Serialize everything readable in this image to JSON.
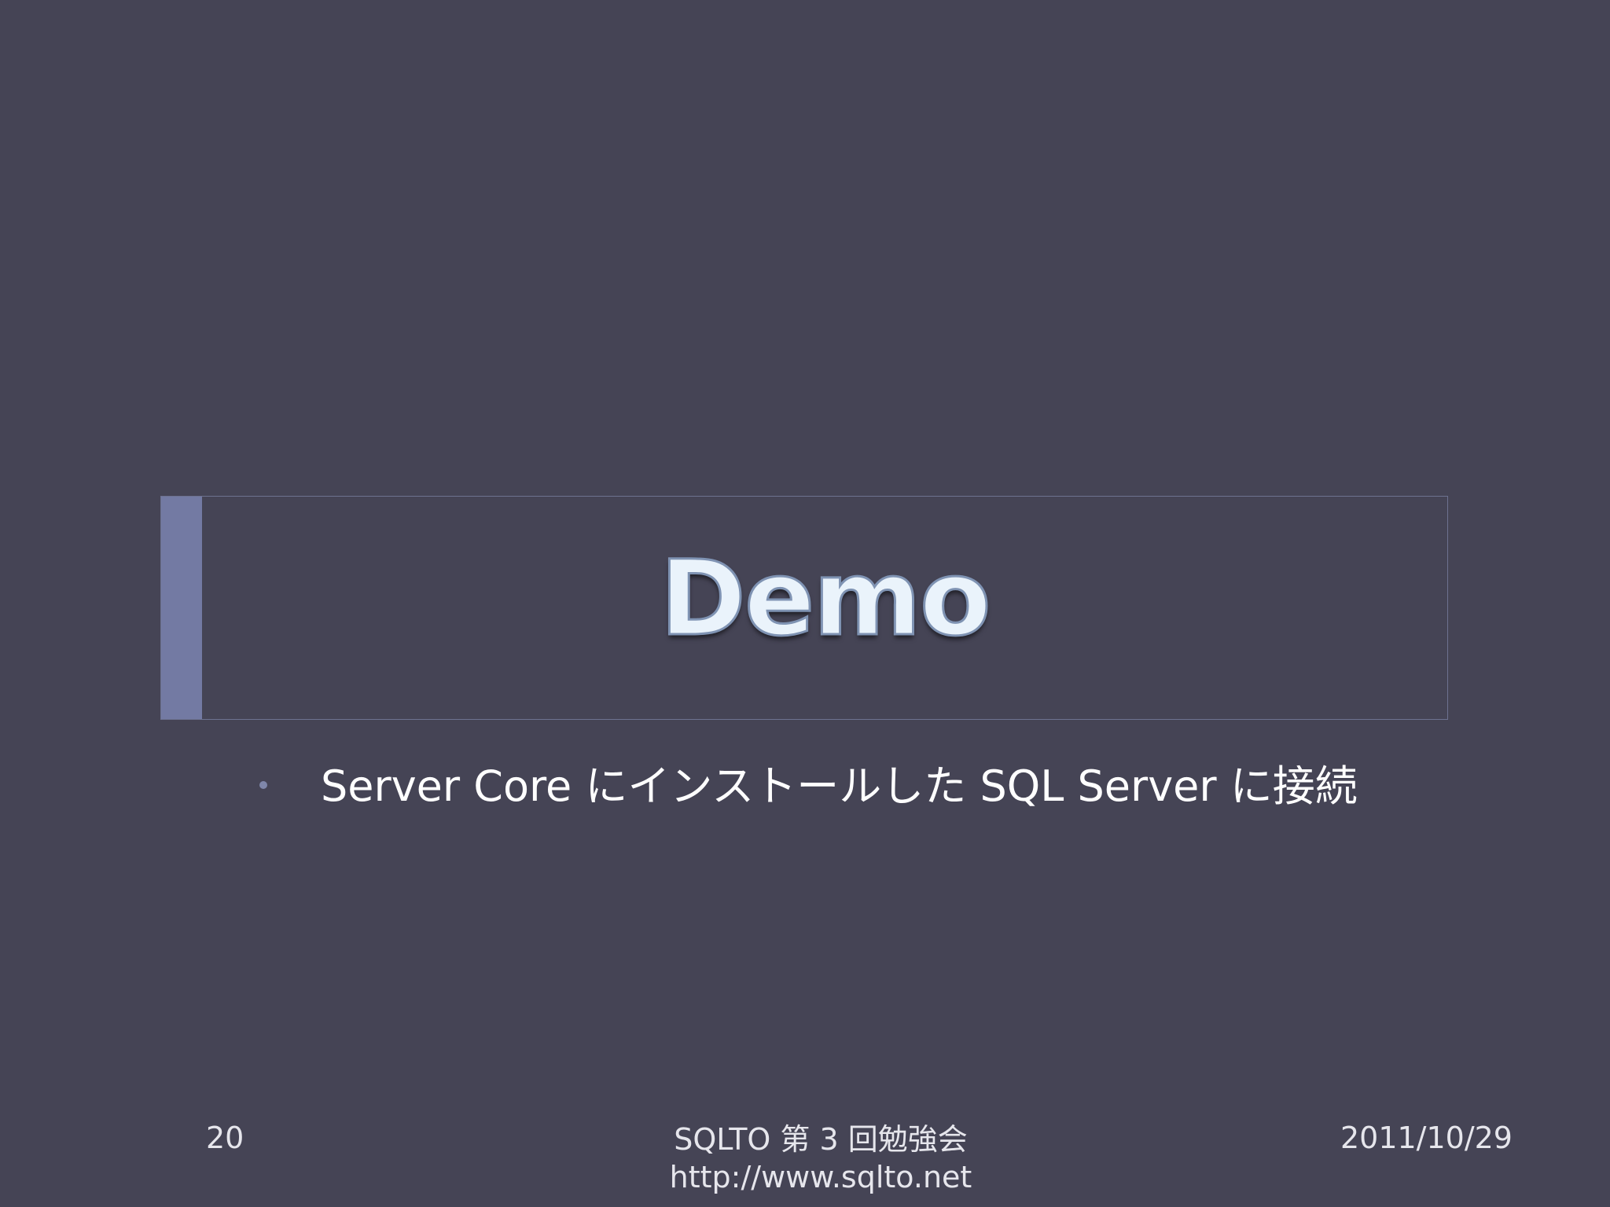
{
  "slide": {
    "title": "Demo",
    "bullets": [
      "Server Core にインストールした SQL Server に接続"
    ]
  },
  "footer": {
    "page_number": "20",
    "event_name": "SQLTO 第 3 回勉強会",
    "url": "http://www.sqlto.net",
    "date": "2011/10/29"
  },
  "colors": {
    "background": "#454455",
    "accent_bar": "#737aa3",
    "title_fill": "#eaf3fb",
    "title_outline": "#7f93b3"
  }
}
